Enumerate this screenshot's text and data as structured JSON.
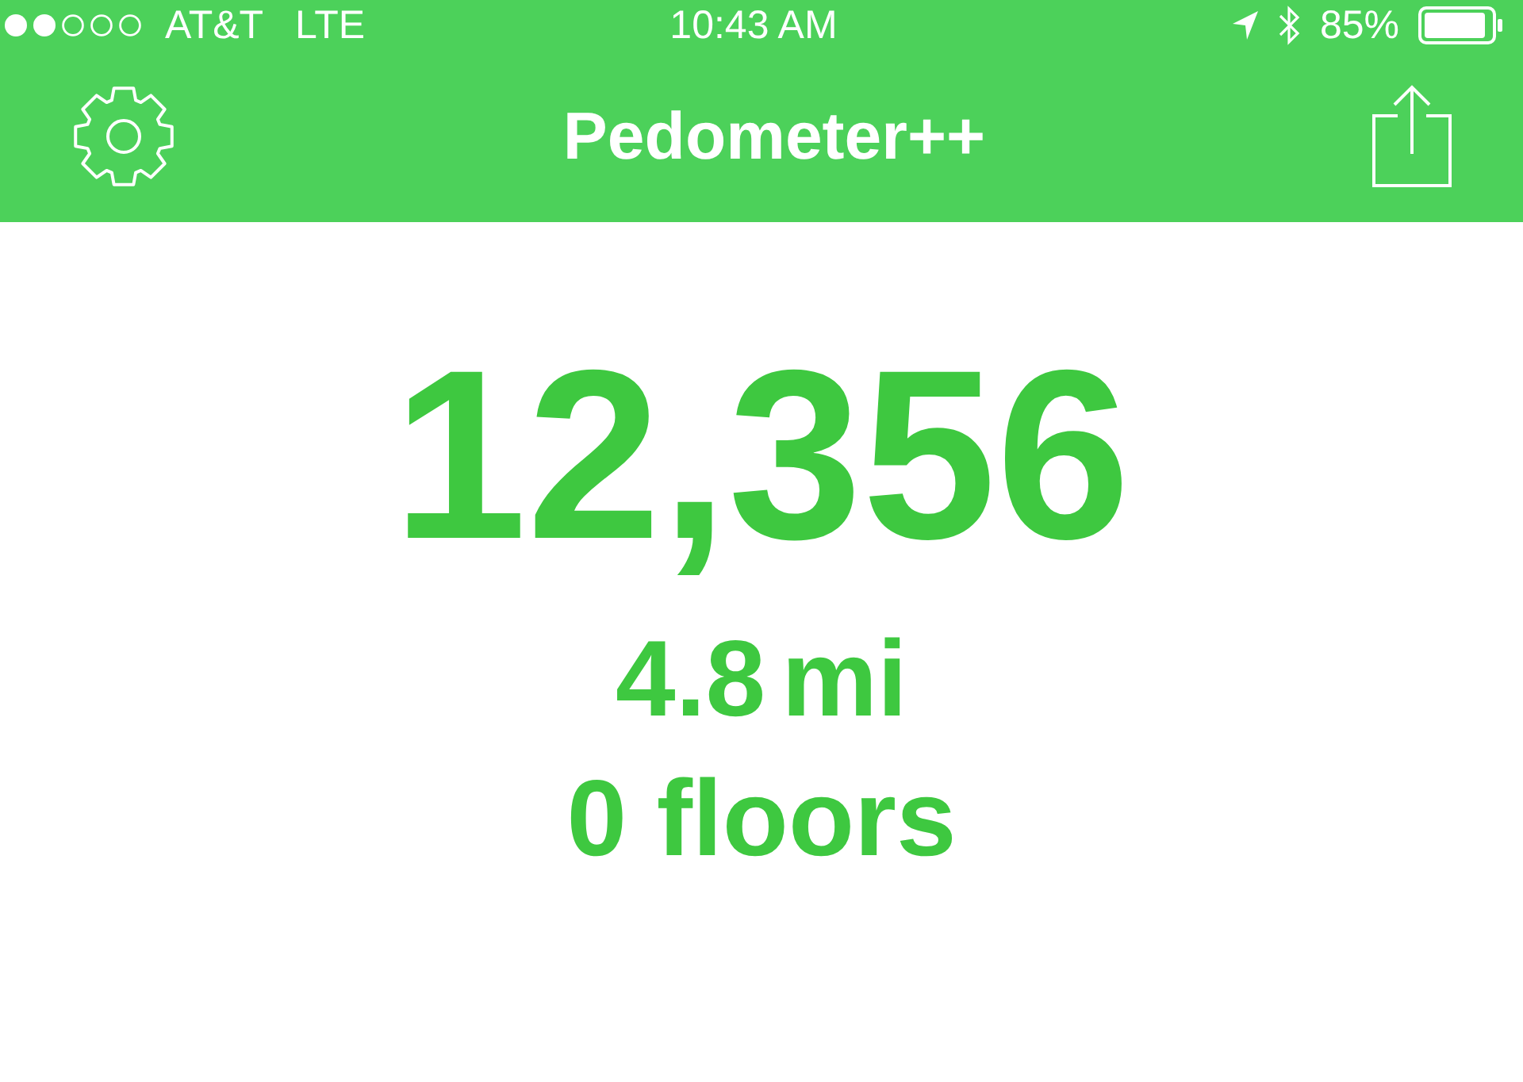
{
  "status_bar": {
    "carrier": "AT&T",
    "network": "LTE",
    "time": "10:43 AM",
    "battery": "85%"
  },
  "nav_bar": {
    "title": "Pedometer++"
  },
  "stats": {
    "steps": "12,356",
    "distance": "4.8",
    "distance_unit": "mi",
    "floors": "0 floors"
  }
}
